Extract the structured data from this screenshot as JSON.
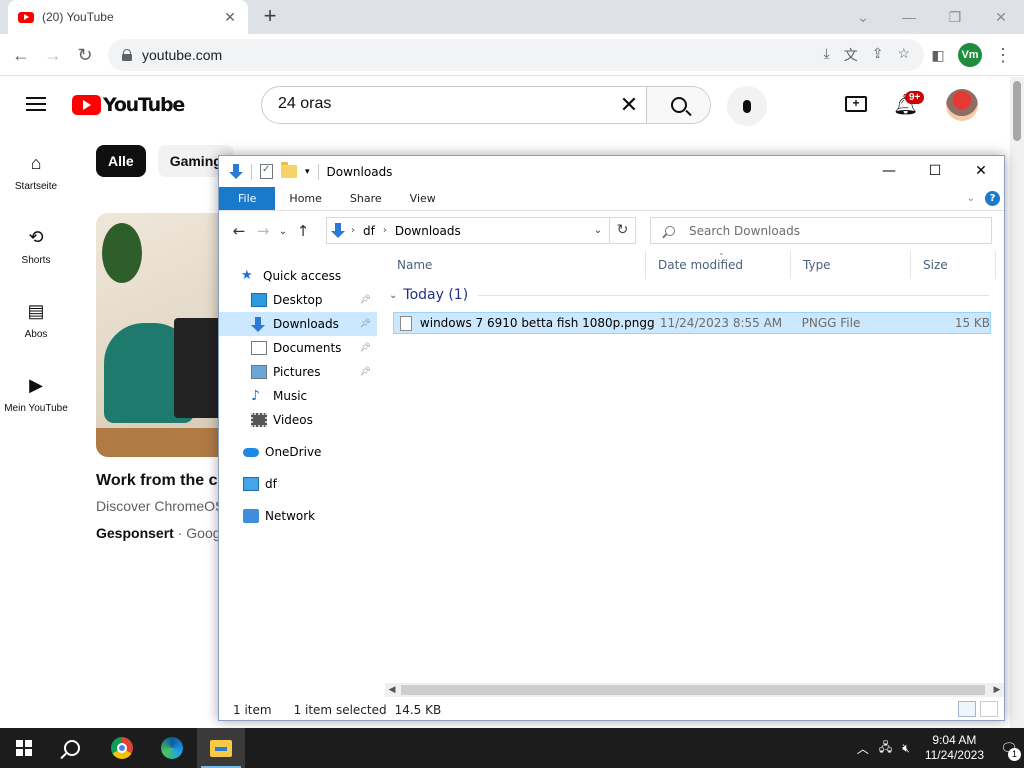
{
  "browser": {
    "tab_title": "(20) YouTube",
    "tab_close": "✕",
    "new_tab": "+",
    "url": "youtube.com",
    "profile_initials": "Vm",
    "window_controls": {
      "chevron": "⌄",
      "minimize": "—",
      "restore": "❐",
      "close": "✕"
    }
  },
  "youtube": {
    "logo_text": "YouTube",
    "search_query": "24 oras",
    "clear_glyph": "✕",
    "notification_badge": "9+",
    "sidebar": [
      {
        "label": "Startseite",
        "icon": "home-icon"
      },
      {
        "label": "Shorts",
        "icon": "shorts-icon"
      },
      {
        "label": "Abos",
        "icon": "subscriptions-icon"
      },
      {
        "label": "Mein YouTube",
        "icon": "library-icon"
      }
    ],
    "chips": [
      "Alle",
      "Gaming"
    ],
    "ad": {
      "title": "Work from the clo",
      "description": "Discover ChromeOS",
      "sponsored": "Gesponsert",
      "advertiser": "Goog"
    }
  },
  "explorer": {
    "title": "Downloads",
    "ribbon_tabs": [
      "File",
      "Home",
      "Share",
      "View"
    ],
    "help": "?",
    "breadcrumb": [
      "df",
      "Downloads"
    ],
    "search_placeholder": "Search Downloads",
    "nav_items": [
      {
        "label": "Quick access",
        "icon": "star-icon"
      },
      {
        "label": "Desktop",
        "icon": "desktop-icon",
        "pinned": true
      },
      {
        "label": "Downloads",
        "icon": "download-icon",
        "pinned": true,
        "selected": true
      },
      {
        "label": "Documents",
        "icon": "documents-icon",
        "pinned": true
      },
      {
        "label": "Pictures",
        "icon": "pictures-icon",
        "pinned": true
      },
      {
        "label": "Music",
        "icon": "music-icon"
      },
      {
        "label": "Videos",
        "icon": "videos-icon"
      },
      {
        "label": "OneDrive",
        "icon": "cloud-icon"
      },
      {
        "label": "df",
        "icon": "computer-icon"
      },
      {
        "label": "Network",
        "icon": "network-icon"
      }
    ],
    "columns": [
      "Name",
      "Date modified",
      "Type",
      "Size"
    ],
    "group": "Today (1)",
    "files": [
      {
        "name": "windows 7 6910 betta fish 1080p.pngg",
        "date": "11/24/2023 8:55 AM",
        "type": "PNGG File",
        "size": "15 KB"
      }
    ],
    "status": {
      "count": "1 item",
      "selected": "1 item selected",
      "size": "14.5 KB"
    }
  },
  "taskbar": {
    "time": "9:04 AM",
    "date": "11/24/2023",
    "notification_count": "1"
  }
}
